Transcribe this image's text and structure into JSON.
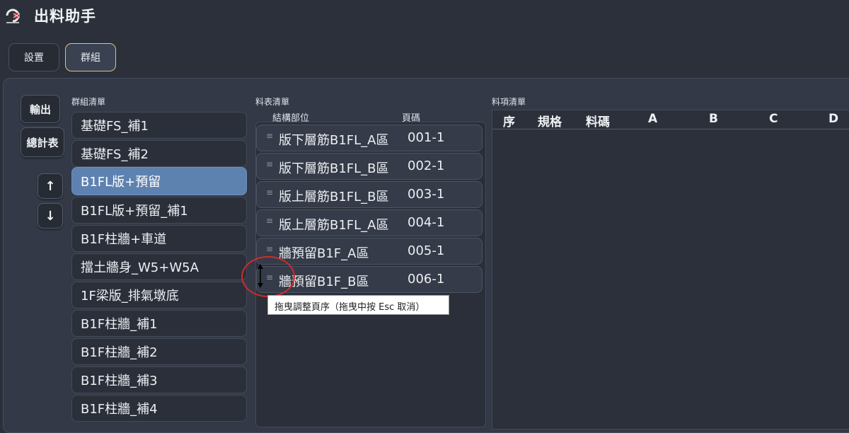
{
  "app": {
    "title": "出料助手",
    "logo_icon": "spider-logo"
  },
  "tabs": [
    {
      "label": "設置",
      "active": false
    },
    {
      "label": "群組",
      "active": true
    }
  ],
  "group_panel": {
    "label": "群組清單",
    "export_button": "輸出",
    "summary_button": "總計表",
    "move_up": "↑",
    "move_down": "↓",
    "items": [
      "基礎FS_補1",
      "基礎FS_補2",
      "B1FL版+預留",
      "B1FL版+預留_補1",
      "B1F柱牆+車道",
      "擋土牆身_W5+W5A",
      "1F梁版_排氣墩底",
      "B1F柱牆_補1",
      "B1F柱牆_補2",
      "B1F柱牆_補3",
      "B1F柱牆_補4"
    ],
    "selected_index": 2
  },
  "sheet_panel": {
    "label": "料表清單",
    "col_part": "結構部位",
    "col_page": "頁碼",
    "rows": [
      {
        "part": "版下層筋B1FL_A區",
        "page": "001-1"
      },
      {
        "part": "版下層筋B1FL_B區",
        "page": "002-1"
      },
      {
        "part": "版上層筋B1FL_B區",
        "page": "003-1"
      },
      {
        "part": "版上層筋B1FL_A區",
        "page": "004-1"
      },
      {
        "part": "牆預留B1F_A區",
        "page": "005-1"
      },
      {
        "part": "牆預留B1F_B區",
        "page": "006-1"
      }
    ],
    "grip_icon": "≡"
  },
  "items_panel": {
    "label": "料項清單",
    "columns": [
      "序",
      "規格",
      "料碼",
      "A",
      "B",
      "C",
      "D"
    ]
  },
  "tooltip": {
    "text": "拖曳調整頁序（拖曳中按 Esc 取消）"
  },
  "colors": {
    "background": "#2b303a",
    "panel": "#333947",
    "selected": "#5e82b0",
    "active_tab_border": "#d9c38a",
    "annotation_circle": "#d42a2a"
  }
}
